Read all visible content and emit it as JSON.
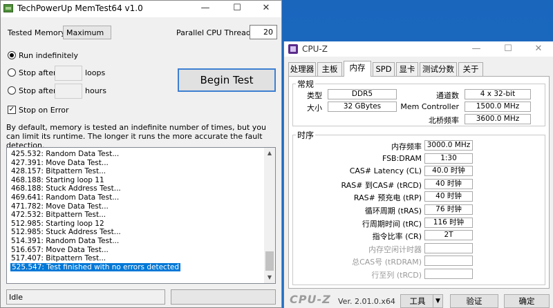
{
  "memtest": {
    "title": "TechPowerUp MemTest64 v1.0",
    "tested_memory_label": "Tested Memory:",
    "tested_memory_value": "Maximum",
    "threads_label": "Parallel CPU Threads:",
    "threads_value": "20",
    "run_indefinitely": "Run indefinitely",
    "stop_after": "Stop after",
    "loops": "loops",
    "hours": "hours",
    "stop_on_error": "Stop on Error",
    "begin_test": "Begin Test",
    "description": "By default, memory is tested an indefinite number of times, but you can limit its runtime. The longer it runs the more accurate the fault detection.",
    "log": [
      "425.532: Random Data Test...",
      "427.391: Move Data Test...",
      "428.157: Bitpattern Test...",
      "468.188: Starting loop 11",
      "468.188: Stuck Address Test...",
      "469.641: Random Data Test...",
      "471.782: Move Data Test...",
      "472.532: Bitpattern Test...",
      "512.985: Starting loop 12",
      "512.985: Stuck Address Test...",
      "514.391: Random Data Test...",
      "516.657: Move Data Test...",
      "517.407: Bitpattern Test...",
      "525.547: Test finished with no errors detected"
    ],
    "status": "Idle",
    "selected_line": 13
  },
  "cpuz": {
    "title": "CPU-Z",
    "tabs": [
      "处理器",
      "主板",
      "内存",
      "SPD",
      "显卡",
      "测试分数",
      "关于"
    ],
    "active_tab": 2,
    "general": {
      "title": "常规",
      "type_label": "类型",
      "type_value": "DDR5",
      "channels_label": "通道数",
      "channels_value": "4 x 32-bit",
      "size_label": "大小",
      "size_value": "32 GBytes",
      "mc_label": "Mem Controller",
      "mc_value": "1500.0 MHz",
      "nb_label": "北桥频率",
      "nb_value": "3600.0 MHz"
    },
    "timings": {
      "title": "时序",
      "rows": [
        {
          "label": "内存频率",
          "value": "3000.0 MHz",
          "dim": false
        },
        {
          "label": "FSB:DRAM",
          "value": "1:30",
          "dim": false
        },
        {
          "label": "CAS# Latency (CL)",
          "value": "40.0 时钟",
          "dim": false
        },
        {
          "label": "RAS# 到CAS# (tRCD)",
          "value": "40 时钟",
          "dim": false
        },
        {
          "label": "RAS# 预充电 (tRP)",
          "value": "40 时钟",
          "dim": false
        },
        {
          "label": "循环周期 (tRAS)",
          "value": "76 时钟",
          "dim": false
        },
        {
          "label": "行周期时间 (tRC)",
          "value": "116 时钟",
          "dim": false
        },
        {
          "label": "指令比率 (CR)",
          "value": "2T",
          "dim": false
        },
        {
          "label": "内存空闲计时器",
          "value": "",
          "dim": true
        },
        {
          "label": "总CAS号 (tRDRAM)",
          "value": "",
          "dim": true
        },
        {
          "label": "行至列 (tRCD)",
          "value": "",
          "dim": true
        }
      ]
    },
    "logo": "CPU-Z",
    "version": "Ver. 2.01.0.x64",
    "tools_label": "工具",
    "validate_label": "验证",
    "ok_label": "确定"
  }
}
